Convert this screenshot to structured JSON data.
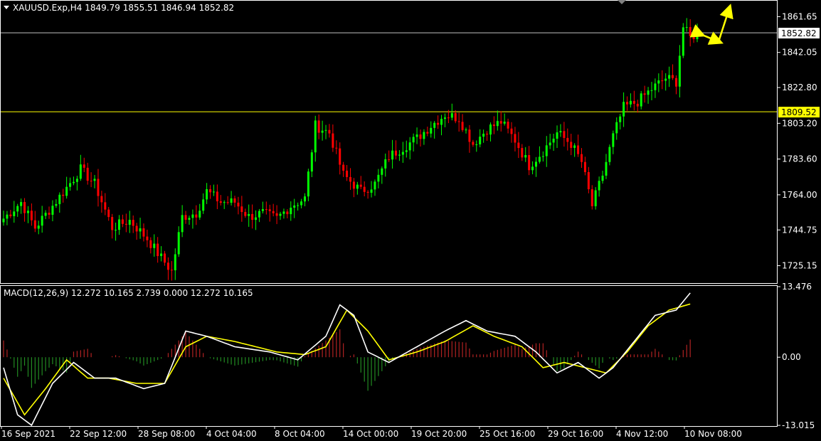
{
  "chart_header": {
    "symbol_line": "XAUUSD.Exp,H4  1849.79 1855.51 1846.94 1852.82",
    "macd_line": "MACD(12,26,9) 12.272 10.165 2.739 0.000 12.272 10.165"
  },
  "price_axis": {
    "ticks": [
      "1861.65",
      "1842.05",
      "1822.80",
      "1803.20",
      "1783.60",
      "1764.00",
      "1744.75",
      "1725.15"
    ],
    "tick_values": [
      1861.65,
      1842.05,
      1822.8,
      1803.2,
      1783.6,
      1764.0,
      1744.75,
      1725.15
    ],
    "current_price_label": "1852.82",
    "current_price": 1852.82,
    "level_label": "1809.52",
    "level_price": 1809.52
  },
  "macd_axis": {
    "ticks": [
      "13.476",
      "0.00",
      "-13.015"
    ],
    "tick_values": [
      13.476,
      0.0,
      -13.015
    ]
  },
  "time_axis": {
    "labels": [
      "16 Sep 2021",
      "22 Sep 12:00",
      "28 Sep 08:00",
      "4 Oct 04:00",
      "8 Oct 04:00",
      "14 Oct 00:00",
      "19 Oct 20:00",
      "25 Oct 16:00",
      "29 Oct 16:00",
      "4 Nov 12:00",
      "10 Nov 08:00"
    ]
  },
  "colors": {
    "background": "#000000",
    "bull": "#00ff00",
    "bear": "#ff0000",
    "level_line": "#ffff00",
    "price_line": "#c0c0c0",
    "macd_line": "#ffffff",
    "signal_line": "#ffff00",
    "hist_pos": "#b22222",
    "hist_neg": "#228b22",
    "forecast_arrow": "#ffff00"
  },
  "chart_data": {
    "type": "candlestick",
    "title": "XAUUSD.Exp,H4",
    "price_range": [
      1716,
      1870
    ],
    "macd_range": [
      -13.015,
      13.476
    ],
    "close_waypoints": [
      [
        0,
        1751
      ],
      [
        5,
        1760
      ],
      [
        9,
        1746
      ],
      [
        14,
        1758
      ],
      [
        18,
        1768
      ],
      [
        22,
        1778
      ],
      [
        26,
        1770
      ],
      [
        31,
        1746
      ],
      [
        36,
        1750
      ],
      [
        41,
        1740
      ],
      [
        44,
        1732
      ],
      [
        48,
        1722
      ],
      [
        51,
        1752
      ],
      [
        55,
        1754
      ],
      [
        58,
        1766
      ],
      [
        62,
        1760
      ],
      [
        66,
        1760
      ],
      [
        70,
        1752
      ],
      [
        74,
        1754
      ],
      [
        78,
        1751
      ],
      [
        82,
        1758
      ],
      [
        86,
        1762
      ],
      [
        89,
        1802
      ],
      [
        93,
        1798
      ],
      [
        97,
        1775
      ],
      [
        102,
        1766
      ],
      [
        106,
        1770
      ],
      [
        110,
        1785
      ],
      [
        114,
        1790
      ],
      [
        118,
        1795
      ],
      [
        122,
        1802
      ],
      [
        126,
        1808
      ],
      [
        130,
        1806
      ],
      [
        134,
        1792
      ],
      [
        138,
        1800
      ],
      [
        142,
        1804
      ],
      [
        146,
        1794
      ],
      [
        150,
        1780
      ],
      [
        154,
        1788
      ],
      [
        158,
        1798
      ],
      [
        162,
        1792
      ],
      [
        165,
        1782
      ],
      [
        168,
        1758
      ],
      [
        171,
        1775
      ],
      [
        174,
        1796
      ],
      [
        177,
        1812
      ],
      [
        181,
        1815
      ],
      [
        185,
        1822
      ],
      [
        189,
        1828
      ],
      [
        192,
        1826
      ],
      [
        194,
        1856
      ],
      [
        196,
        1850
      ],
      [
        198,
        1852.82
      ]
    ],
    "macd_waypoints": [
      [
        0,
        -2
      ],
      [
        4,
        -11
      ],
      [
        8,
        -13
      ],
      [
        14,
        -5
      ],
      [
        20,
        -1
      ],
      [
        26,
        -4
      ],
      [
        32,
        -4
      ],
      [
        40,
        -6
      ],
      [
        46,
        -5
      ],
      [
        52,
        5
      ],
      [
        58,
        4
      ],
      [
        66,
        2
      ],
      [
        76,
        1
      ],
      [
        84,
        -0.5
      ],
      [
        92,
        4
      ],
      [
        96,
        10
      ],
      [
        100,
        8
      ],
      [
        104,
        1
      ],
      [
        110,
        -1
      ],
      [
        118,
        2
      ],
      [
        126,
        5
      ],
      [
        132,
        7
      ],
      [
        138,
        5
      ],
      [
        146,
        4
      ],
      [
        152,
        1
      ],
      [
        158,
        -3
      ],
      [
        164,
        -1
      ],
      [
        170,
        -4
      ],
      [
        174,
        -2
      ],
      [
        180,
        3
      ],
      [
        186,
        8
      ],
      [
        192,
        9
      ],
      [
        196,
        12.272
      ]
    ],
    "signal_waypoints": [
      [
        0,
        -4
      ],
      [
        6,
        -11
      ],
      [
        12,
        -6
      ],
      [
        18,
        -0.5
      ],
      [
        24,
        -4
      ],
      [
        30,
        -4
      ],
      [
        38,
        -5
      ],
      [
        46,
        -5
      ],
      [
        52,
        2
      ],
      [
        58,
        4
      ],
      [
        66,
        3
      ],
      [
        78,
        1
      ],
      [
        86,
        0.5
      ],
      [
        92,
        2
      ],
      [
        98,
        9
      ],
      [
        104,
        5
      ],
      [
        110,
        -0.5
      ],
      [
        118,
        1
      ],
      [
        126,
        3
      ],
      [
        134,
        6
      ],
      [
        140,
        4
      ],
      [
        148,
        2
      ],
      [
        154,
        -2
      ],
      [
        160,
        -1
      ],
      [
        166,
        -2
      ],
      [
        172,
        -3
      ],
      [
        178,
        1
      ],
      [
        184,
        6
      ],
      [
        190,
        9
      ],
      [
        196,
        10.165
      ]
    ],
    "forecast_path": [
      [
        1852,
        0.0
      ],
      [
        1848,
        1.0
      ],
      [
        1866,
        3.6
      ]
    ],
    "xaxis_labels": [
      "16 Sep 2021",
      "22 Sep 12:00",
      "28 Sep 08:00",
      "4 Oct 04:00",
      "8 Oct 04:00",
      "14 Oct 00:00",
      "19 Oct 20:00",
      "25 Oct 16:00",
      "29 Oct 16:00",
      "4 Nov 12:00",
      "10 Nov 08:00"
    ]
  }
}
